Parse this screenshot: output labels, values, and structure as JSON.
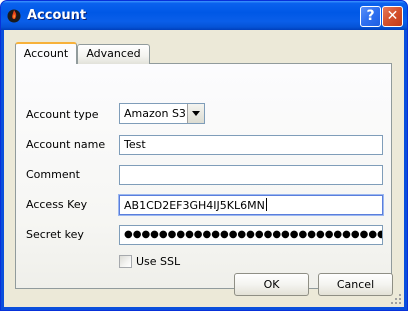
{
  "window": {
    "title": "Account",
    "app_icon": "flame-icon",
    "help_button": "?",
    "close_button": "✕"
  },
  "tabs": [
    {
      "label": "Account",
      "selected": true
    },
    {
      "label": "Advanced",
      "selected": false
    }
  ],
  "form": {
    "account_type": {
      "label": "Account type",
      "value": "Amazon S3"
    },
    "account_name": {
      "label": "Account name",
      "value": "Test"
    },
    "comment": {
      "label": "Comment",
      "value": ""
    },
    "access_key": {
      "label": "Access Key",
      "value": "AB1CD2EF3GH4IJ5KL6MN"
    },
    "secret_key": {
      "label": "Secret key",
      "value": "●●●●●●●●●●●●●●●●●●●●●●●●●●●●●●●●●●●●●●●●"
    },
    "use_ssl": {
      "label": "Use SSL",
      "checked": false
    }
  },
  "buttons": {
    "ok": "OK",
    "cancel": "Cancel"
  },
  "colors": {
    "titlebar": "#0058e6",
    "dialog_bg": "#ece9d8",
    "tab_accent": "#f7b13a",
    "close_red": "#d4502c"
  }
}
